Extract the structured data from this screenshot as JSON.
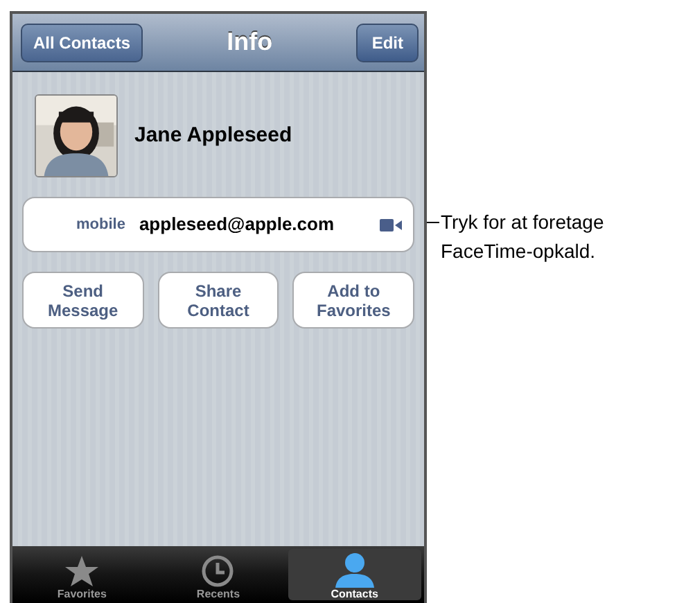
{
  "nav_bar": {
    "back_button": "All Contacts",
    "title": "Info",
    "edit_button": "Edit"
  },
  "contact": {
    "name": "Jane Appleseed"
  },
  "field": {
    "label": "mobile",
    "value": "appleseed@apple.com"
  },
  "actions": [
    "Send Message",
    "Share Contact",
    "Add to Favorites"
  ],
  "tab_bar": [
    {
      "label": "Favorites",
      "kind": "star",
      "selected": false
    },
    {
      "label": "Recents",
      "kind": "clock",
      "selected": false
    },
    {
      "label": "Contacts",
      "kind": "person",
      "selected": true
    }
  ],
  "callout": [
    "Tryk for at foretage",
    "FaceTime-opkald."
  ]
}
